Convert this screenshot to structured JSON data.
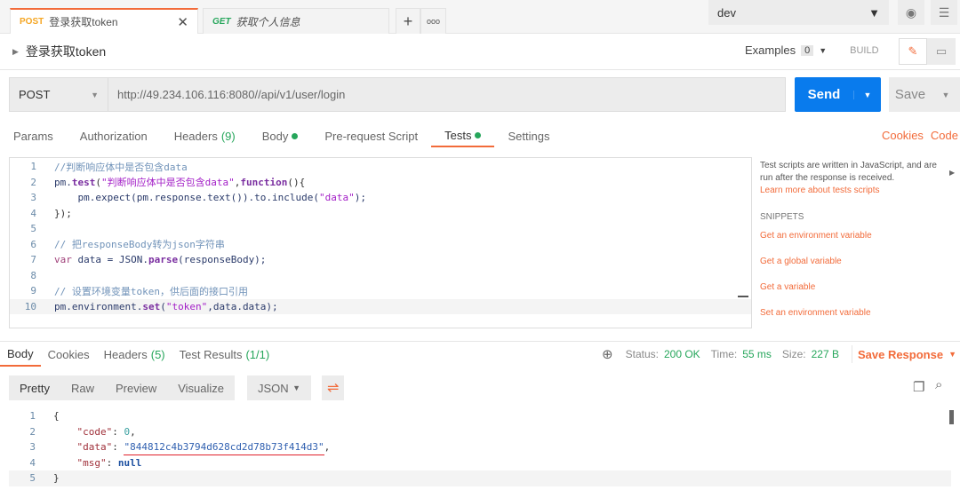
{
  "tabs": [
    {
      "method": "POST",
      "title": "登录获取token"
    },
    {
      "method": "GET",
      "title": "获取个人信息"
    }
  ],
  "environment": "dev",
  "request_name": "登录获取token",
  "examples_label": "Examples",
  "examples_count": "0",
  "build_label": "BUILD",
  "method": "POST",
  "url": "http://49.234.106.116:8080//api/v1/user/login",
  "send_label": "Send",
  "save_label": "Save",
  "req_tabs": [
    {
      "label": "Params"
    },
    {
      "label": "Authorization"
    },
    {
      "label": "Headers",
      "count": "(9)"
    },
    {
      "label": "Body",
      "dot": true
    },
    {
      "label": "Pre-request Script"
    },
    {
      "label": "Tests",
      "dot": true,
      "active": true
    },
    {
      "label": "Settings"
    }
  ],
  "cookies_link": "Cookies",
  "code_link": "Code",
  "script_lines": [
    [
      [
        "c-cm",
        "//判断响应体中是否包含data"
      ]
    ],
    [
      [
        "c-id",
        "pm."
      ],
      [
        "c-fn",
        "test"
      ],
      [
        "c-p",
        "("
      ],
      [
        "c-str",
        "\"判断响应体中是否包含data\""
      ],
      [
        "c-p",
        ","
      ],
      [
        "c-fn",
        "function"
      ],
      [
        "c-p",
        "(){"
      ]
    ],
    [
      [
        "c-id",
        "    pm.expect(pm.response.text()).to.include("
      ],
      [
        "c-str",
        "\"data\""
      ],
      [
        "c-id",
        ");"
      ]
    ],
    [
      [
        "c-p",
        "});"
      ]
    ],
    [],
    [
      [
        "c-cm",
        "// 把responseBody转为json字符串"
      ]
    ],
    [
      [
        "c-kw",
        "var"
      ],
      [
        "c-id",
        " data = JSON."
      ],
      [
        "c-fn",
        "parse"
      ],
      [
        "c-id",
        "(responseBody);"
      ]
    ],
    [],
    [
      [
        "c-cm",
        "// 设置环境变量token，供后面的接口引用"
      ]
    ],
    [
      [
        "c-id",
        "pm.environment."
      ],
      [
        "c-fn",
        "set"
      ],
      [
        "c-id",
        "("
      ],
      [
        "c-str",
        "\"token\""
      ],
      [
        "c-id",
        ",data.data);"
      ]
    ]
  ],
  "sidebar": {
    "intro": "Test scripts are written in JavaScript, and are run after the response is received.",
    "learn_more": "Learn more about tests scripts",
    "snippets_title": "SNIPPETS",
    "snippets": [
      "Get an environment variable",
      "Get a global variable",
      "Get a variable",
      "Set an environment variable"
    ]
  },
  "res_tabs": [
    {
      "label": "Body",
      "active": true
    },
    {
      "label": "Cookies"
    },
    {
      "label": "Headers",
      "count": "(5)"
    },
    {
      "label": "Test Results",
      "count": "(1/1)"
    }
  ],
  "status": {
    "status_label": "Status:",
    "status": "200 OK",
    "time_label": "Time:",
    "time": "55 ms",
    "size_label": "Size:",
    "size": "227 B",
    "save_response": "Save Response"
  },
  "formats": [
    "Pretty",
    "Raw",
    "Preview",
    "Visualize"
  ],
  "format_type": "JSON",
  "response_lines": [
    [
      [
        "c-p",
        "{"
      ]
    ],
    [
      [
        "c-key",
        "    \"code\""
      ],
      [
        "c-p",
        ": "
      ],
      [
        "c-num",
        "0"
      ],
      [
        "c-p",
        ","
      ]
    ],
    [
      [
        "c-key",
        "    \"data\""
      ],
      [
        "c-p",
        ": "
      ],
      [
        "c-sv u",
        "\"844812c4b3794d628cd2d78b73f414d3\""
      ],
      [
        "c-p",
        ","
      ]
    ],
    [
      [
        "c-key",
        "    \"msg\""
      ],
      [
        "c-p",
        ": "
      ],
      [
        "c-null",
        "null"
      ]
    ],
    [
      [
        "c-p",
        "}"
      ]
    ]
  ],
  "colors": {
    "accent": "#f26b3a",
    "send": "#097bed",
    "success": "#26a65b",
    "annotation_underline": "#e0202a"
  }
}
